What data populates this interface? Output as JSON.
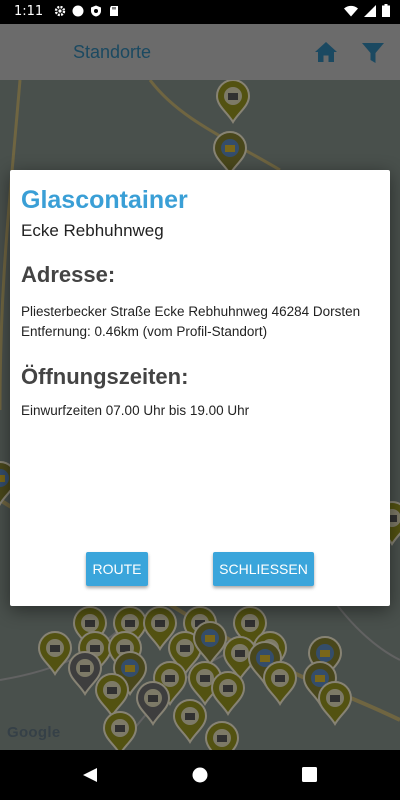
{
  "status_bar": {
    "time": "1:11",
    "icons": [
      "gear-icon",
      "circle-icon",
      "shield-icon",
      "sd-card-icon"
    ],
    "right_icons": [
      "wifi-icon",
      "signal-icon",
      "battery-icon"
    ]
  },
  "app_bar": {
    "title": "Standorte",
    "actions": [
      "home-icon",
      "filter-icon"
    ],
    "accent_color": "#2f7fa8"
  },
  "map": {
    "attribution": "Google",
    "marker_types": [
      "glass-container-marker",
      "clothing-container-marker",
      "recycling-station-marker"
    ]
  },
  "dialog": {
    "title": "Glascontainer",
    "subtitle": "Ecke Rebhuhnweg",
    "address_heading": "Adresse:",
    "address": "Pliesterbecker Straße Ecke Rebhuhnweg 46284 Dorsten",
    "distance": "Entfernung: 0.46km (vom Profil-Standort)",
    "hours_heading": "Öffnungszeiten:",
    "hours": "Einwurfzeiten 07.00 Uhr bis 19.00 Uhr",
    "route_button": "ROUTE",
    "close_button": "SCHLIESSEN",
    "title_color": "#3a9fd6",
    "button_color": "#3aa5db"
  },
  "nav_bar": {
    "buttons": [
      "back-icon",
      "home-circle-icon",
      "recents-icon"
    ]
  }
}
